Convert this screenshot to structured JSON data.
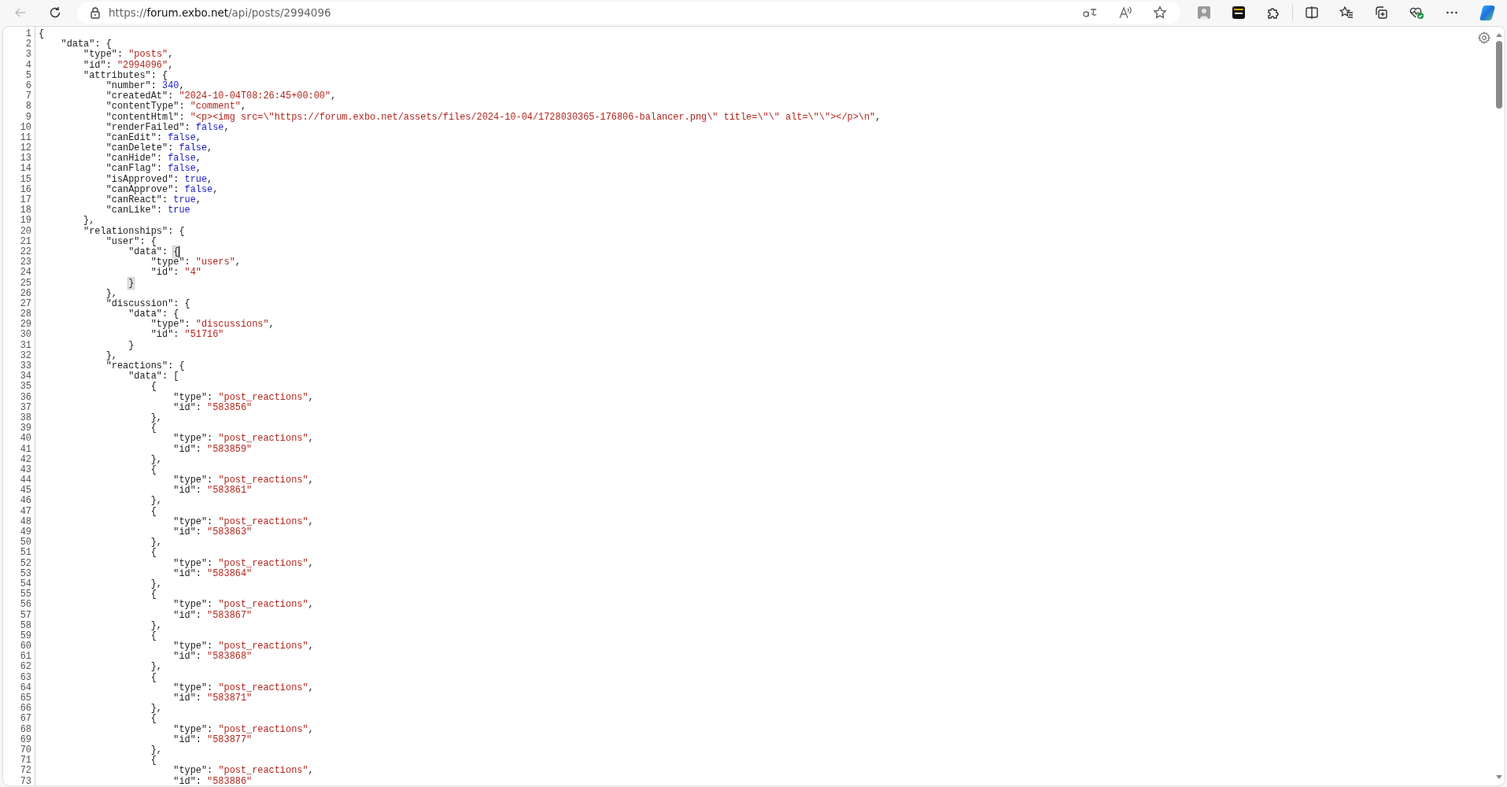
{
  "toolbar": {
    "back_button": {
      "disabled": true
    },
    "url": {
      "scheme": "https://",
      "host": "forum.exbo.net",
      "path": "/api/posts/2994096"
    }
  },
  "viewer": {
    "lines": [
      {
        "number": "1",
        "tokens": [
          {
            "kind": "punct",
            "text": "{"
          }
        ]
      },
      {
        "number": "2",
        "tokens": [
          {
            "kind": "key",
            "text": "\"data\""
          },
          {
            "kind": "punct",
            "text": ": {"
          }
        ]
      },
      {
        "number": "3",
        "tokens": [
          {
            "kind": "key",
            "text": "\"type\""
          },
          {
            "kind": "punct",
            "text": ": "
          },
          {
            "kind": "string",
            "text": "\"posts\""
          },
          {
            "kind": "punct",
            "text": ","
          }
        ]
      },
      {
        "number": "4",
        "tokens": [
          {
            "kind": "key",
            "text": "\"id\""
          },
          {
            "kind": "punct",
            "text": ": "
          },
          {
            "kind": "string",
            "text": "\"2994096\""
          },
          {
            "kind": "punct",
            "text": ","
          }
        ]
      },
      {
        "number": "5",
        "tokens": [
          {
            "kind": "key",
            "text": "\"attributes\""
          },
          {
            "kind": "punct",
            "text": ": {"
          }
        ]
      },
      {
        "number": "6",
        "tokens": [
          {
            "kind": "key",
            "text": "\"number\""
          },
          {
            "kind": "punct",
            "text": ": "
          },
          {
            "kind": "literal",
            "text": "340"
          },
          {
            "kind": "punct",
            "text": ","
          }
        ]
      },
      {
        "number": "7",
        "tokens": [
          {
            "kind": "key",
            "text": "\"createdAt\""
          },
          {
            "kind": "punct",
            "text": ": "
          },
          {
            "kind": "string",
            "text": "\"2024-10-04T08:26:45+00:00\""
          },
          {
            "kind": "punct",
            "text": ","
          }
        ]
      },
      {
        "number": "8",
        "tokens": [
          {
            "kind": "key",
            "text": "\"contentType\""
          },
          {
            "kind": "punct",
            "text": ": "
          },
          {
            "kind": "string",
            "text": "\"comment\""
          },
          {
            "kind": "punct",
            "text": ","
          }
        ]
      },
      {
        "number": "9",
        "tokens": [
          {
            "kind": "key",
            "text": "\"contentHtml\""
          },
          {
            "kind": "punct",
            "text": ": "
          },
          {
            "kind": "string",
            "text": "\"<p><img src=\\\"https://forum.exbo.net/assets/files/2024-10-04/1728030365-176806-balancer.png\\\" title=\\\"\\\" alt=\\\"\\\"></p>\\n\""
          },
          {
            "kind": "punct",
            "text": ","
          }
        ]
      },
      {
        "number": "10",
        "tokens": [
          {
            "kind": "key",
            "text": "\"renderFailed\""
          },
          {
            "kind": "punct",
            "text": ": "
          },
          {
            "kind": "literal",
            "text": "false"
          },
          {
            "kind": "punct",
            "text": ","
          }
        ]
      },
      {
        "number": "11",
        "tokens": [
          {
            "kind": "key",
            "text": "\"canEdit\""
          },
          {
            "kind": "punct",
            "text": ": "
          },
          {
            "kind": "literal",
            "text": "false"
          },
          {
            "kind": "punct",
            "text": ","
          }
        ]
      },
      {
        "number": "12",
        "tokens": [
          {
            "kind": "key",
            "text": "\"canDelete\""
          },
          {
            "kind": "punct",
            "text": ": "
          },
          {
            "kind": "literal",
            "text": "false"
          },
          {
            "kind": "punct",
            "text": ","
          }
        ]
      },
      {
        "number": "13",
        "tokens": [
          {
            "kind": "key",
            "text": "\"canHide\""
          },
          {
            "kind": "punct",
            "text": ": "
          },
          {
            "kind": "literal",
            "text": "false"
          },
          {
            "kind": "punct",
            "text": ","
          }
        ]
      },
      {
        "number": "14",
        "tokens": [
          {
            "kind": "key",
            "text": "\"canFlag\""
          },
          {
            "kind": "punct",
            "text": ": "
          },
          {
            "kind": "literal",
            "text": "false"
          },
          {
            "kind": "punct",
            "text": ","
          }
        ]
      },
      {
        "number": "15",
        "tokens": [
          {
            "kind": "key",
            "text": "\"isApproved\""
          },
          {
            "kind": "punct",
            "text": ": "
          },
          {
            "kind": "literal",
            "text": "true"
          },
          {
            "kind": "punct",
            "text": ","
          }
        ]
      },
      {
        "number": "16",
        "tokens": [
          {
            "kind": "key",
            "text": "\"canApprove\""
          },
          {
            "kind": "punct",
            "text": ": "
          },
          {
            "kind": "literal",
            "text": "false"
          },
          {
            "kind": "punct",
            "text": ","
          }
        ]
      },
      {
        "number": "17",
        "tokens": [
          {
            "kind": "key",
            "text": "\"canReact\""
          },
          {
            "kind": "punct",
            "text": ": "
          },
          {
            "kind": "literal",
            "text": "true"
          },
          {
            "kind": "punct",
            "text": ","
          }
        ]
      },
      {
        "number": "18",
        "tokens": [
          {
            "kind": "key",
            "text": "\"canLike\""
          },
          {
            "kind": "punct",
            "text": ": "
          },
          {
            "kind": "literal",
            "text": "true"
          }
        ]
      },
      {
        "number": "19",
        "tokens": [
          {
            "kind": "punct",
            "text": "},"
          }
        ]
      },
      {
        "number": "20",
        "tokens": [
          {
            "kind": "key",
            "text": "\"relationships\""
          },
          {
            "kind": "punct",
            "text": ": {"
          }
        ]
      },
      {
        "number": "21",
        "tokens": [
          {
            "kind": "key",
            "text": "\"user\""
          },
          {
            "kind": "punct",
            "text": ": {"
          }
        ]
      },
      {
        "number": "22",
        "tokens": [
          {
            "kind": "key",
            "text": "\"data\""
          },
          {
            "kind": "punct",
            "text": ": "
          },
          {
            "kind": "brace-cursor",
            "text": "{"
          }
        ]
      },
      {
        "number": "23",
        "tokens": [
          {
            "kind": "key",
            "text": "\"type\""
          },
          {
            "kind": "punct",
            "text": ": "
          },
          {
            "kind": "string",
            "text": "\"users\""
          },
          {
            "kind": "punct",
            "text": ","
          }
        ]
      },
      {
        "number": "24",
        "tokens": [
          {
            "kind": "key",
            "text": "\"id\""
          },
          {
            "kind": "punct",
            "text": ": "
          },
          {
            "kind": "string",
            "text": "\"4\""
          }
        ]
      },
      {
        "number": "25",
        "tokens": [
          {
            "kind": "brace-match",
            "text": "}"
          }
        ]
      },
      {
        "number": "26",
        "tokens": [
          {
            "kind": "punct",
            "text": "},"
          }
        ]
      },
      {
        "number": "27",
        "tokens": [
          {
            "kind": "key",
            "text": "\"discussion\""
          },
          {
            "kind": "punct",
            "text": ": {"
          }
        ]
      },
      {
        "number": "28",
        "tokens": [
          {
            "kind": "key",
            "text": "\"data\""
          },
          {
            "kind": "punct",
            "text": ": {"
          }
        ]
      },
      {
        "number": "29",
        "tokens": [
          {
            "kind": "key",
            "text": "\"type\""
          },
          {
            "kind": "punct",
            "text": ": "
          },
          {
            "kind": "string",
            "text": "\"discussions\""
          },
          {
            "kind": "punct",
            "text": ","
          }
        ]
      },
      {
        "number": "30",
        "tokens": [
          {
            "kind": "key",
            "text": "\"id\""
          },
          {
            "kind": "punct",
            "text": ": "
          },
          {
            "kind": "string",
            "text": "\"51716\""
          }
        ]
      },
      {
        "number": "31",
        "tokens": [
          {
            "kind": "punct",
            "text": "}"
          }
        ]
      },
      {
        "number": "32",
        "tokens": [
          {
            "kind": "punct",
            "text": "},"
          }
        ]
      },
      {
        "number": "33",
        "tokens": [
          {
            "kind": "key",
            "text": "\"reactions\""
          },
          {
            "kind": "punct",
            "text": ": {"
          }
        ]
      },
      {
        "number": "34",
        "tokens": [
          {
            "kind": "key",
            "text": "\"data\""
          },
          {
            "kind": "punct",
            "text": ": ["
          }
        ]
      },
      {
        "number": "35",
        "tokens": [
          {
            "kind": "punct",
            "text": "{"
          }
        ]
      },
      {
        "number": "36",
        "tokens": [
          {
            "kind": "key",
            "text": "\"type\""
          },
          {
            "kind": "punct",
            "text": ": "
          },
          {
            "kind": "string",
            "text": "\"post_reactions\""
          },
          {
            "kind": "punct",
            "text": ","
          }
        ]
      },
      {
        "number": "37",
        "tokens": [
          {
            "kind": "key",
            "text": "\"id\""
          },
          {
            "kind": "punct",
            "text": ": "
          },
          {
            "kind": "string",
            "text": "\"583856\""
          }
        ]
      },
      {
        "number": "38",
        "tokens": [
          {
            "kind": "punct",
            "text": "},"
          }
        ]
      },
      {
        "number": "39",
        "tokens": [
          {
            "kind": "punct",
            "text": "{"
          }
        ]
      },
      {
        "number": "40",
        "tokens": [
          {
            "kind": "key",
            "text": "\"type\""
          },
          {
            "kind": "punct",
            "text": ": "
          },
          {
            "kind": "string",
            "text": "\"post_reactions\""
          },
          {
            "kind": "punct",
            "text": ","
          }
        ]
      },
      {
        "number": "41",
        "tokens": [
          {
            "kind": "key",
            "text": "\"id\""
          },
          {
            "kind": "punct",
            "text": ": "
          },
          {
            "kind": "string",
            "text": "\"583859\""
          }
        ]
      },
      {
        "number": "42",
        "tokens": [
          {
            "kind": "punct",
            "text": "},"
          }
        ]
      },
      {
        "number": "43",
        "tokens": [
          {
            "kind": "punct",
            "text": "{"
          }
        ]
      },
      {
        "number": "44",
        "tokens": [
          {
            "kind": "key",
            "text": "\"type\""
          },
          {
            "kind": "punct",
            "text": ": "
          },
          {
            "kind": "string",
            "text": "\"post_reactions\""
          },
          {
            "kind": "punct",
            "text": ","
          }
        ]
      },
      {
        "number": "45",
        "tokens": [
          {
            "kind": "key",
            "text": "\"id\""
          },
          {
            "kind": "punct",
            "text": ": "
          },
          {
            "kind": "string",
            "text": "\"583861\""
          }
        ]
      },
      {
        "number": "46",
        "tokens": [
          {
            "kind": "punct",
            "text": "},"
          }
        ]
      },
      {
        "number": "47",
        "tokens": [
          {
            "kind": "punct",
            "text": "{"
          }
        ]
      },
      {
        "number": "48",
        "tokens": [
          {
            "kind": "key",
            "text": "\"type\""
          },
          {
            "kind": "punct",
            "text": ": "
          },
          {
            "kind": "string",
            "text": "\"post_reactions\""
          },
          {
            "kind": "punct",
            "text": ","
          }
        ]
      },
      {
        "number": "49",
        "tokens": [
          {
            "kind": "key",
            "text": "\"id\""
          },
          {
            "kind": "punct",
            "text": ": "
          },
          {
            "kind": "string",
            "text": "\"583863\""
          }
        ]
      },
      {
        "number": "50",
        "tokens": [
          {
            "kind": "punct",
            "text": "},"
          }
        ]
      },
      {
        "number": "51",
        "tokens": [
          {
            "kind": "punct",
            "text": "{"
          }
        ]
      },
      {
        "number": "52",
        "tokens": [
          {
            "kind": "key",
            "text": "\"type\""
          },
          {
            "kind": "punct",
            "text": ": "
          },
          {
            "kind": "string",
            "text": "\"post_reactions\""
          },
          {
            "kind": "punct",
            "text": ","
          }
        ]
      },
      {
        "number": "53",
        "tokens": [
          {
            "kind": "key",
            "text": "\"id\""
          },
          {
            "kind": "punct",
            "text": ": "
          },
          {
            "kind": "string",
            "text": "\"583864\""
          }
        ]
      },
      {
        "number": "54",
        "tokens": [
          {
            "kind": "punct",
            "text": "},"
          }
        ]
      },
      {
        "number": "55",
        "tokens": [
          {
            "kind": "punct",
            "text": "{"
          }
        ]
      },
      {
        "number": "56",
        "tokens": [
          {
            "kind": "key",
            "text": "\"type\""
          },
          {
            "kind": "punct",
            "text": ": "
          },
          {
            "kind": "string",
            "text": "\"post_reactions\""
          },
          {
            "kind": "punct",
            "text": ","
          }
        ]
      },
      {
        "number": "57",
        "tokens": [
          {
            "kind": "key",
            "text": "\"id\""
          },
          {
            "kind": "punct",
            "text": ": "
          },
          {
            "kind": "string",
            "text": "\"583867\""
          }
        ]
      },
      {
        "number": "58",
        "tokens": [
          {
            "kind": "punct",
            "text": "},"
          }
        ]
      },
      {
        "number": "59",
        "tokens": [
          {
            "kind": "punct",
            "text": "{"
          }
        ]
      },
      {
        "number": "60",
        "tokens": [
          {
            "kind": "key",
            "text": "\"type\""
          },
          {
            "kind": "punct",
            "text": ": "
          },
          {
            "kind": "string",
            "text": "\"post_reactions\""
          },
          {
            "kind": "punct",
            "text": ","
          }
        ]
      },
      {
        "number": "61",
        "tokens": [
          {
            "kind": "key",
            "text": "\"id\""
          },
          {
            "kind": "punct",
            "text": ": "
          },
          {
            "kind": "string",
            "text": "\"583868\""
          }
        ]
      },
      {
        "number": "62",
        "tokens": [
          {
            "kind": "punct",
            "text": "},"
          }
        ]
      },
      {
        "number": "63",
        "tokens": [
          {
            "kind": "punct",
            "text": "{"
          }
        ]
      },
      {
        "number": "64",
        "tokens": [
          {
            "kind": "key",
            "text": "\"type\""
          },
          {
            "kind": "punct",
            "text": ": "
          },
          {
            "kind": "string",
            "text": "\"post_reactions\""
          },
          {
            "kind": "punct",
            "text": ","
          }
        ]
      },
      {
        "number": "65",
        "tokens": [
          {
            "kind": "key",
            "text": "\"id\""
          },
          {
            "kind": "punct",
            "text": ": "
          },
          {
            "kind": "string",
            "text": "\"583871\""
          }
        ]
      },
      {
        "number": "66",
        "tokens": [
          {
            "kind": "punct",
            "text": "},"
          }
        ]
      },
      {
        "number": "67",
        "tokens": [
          {
            "kind": "punct",
            "text": "{"
          }
        ]
      },
      {
        "number": "68",
        "tokens": [
          {
            "kind": "key",
            "text": "\"type\""
          },
          {
            "kind": "punct",
            "text": ": "
          },
          {
            "kind": "string",
            "text": "\"post_reactions\""
          },
          {
            "kind": "punct",
            "text": ","
          }
        ]
      },
      {
        "number": "69",
        "tokens": [
          {
            "kind": "key",
            "text": "\"id\""
          },
          {
            "kind": "punct",
            "text": ": "
          },
          {
            "kind": "string",
            "text": "\"583877\""
          }
        ]
      },
      {
        "number": "70",
        "tokens": [
          {
            "kind": "punct",
            "text": "},"
          }
        ]
      },
      {
        "number": "71",
        "tokens": [
          {
            "kind": "punct",
            "text": "{"
          }
        ]
      },
      {
        "number": "72",
        "tokens": [
          {
            "kind": "key",
            "text": "\"type\""
          },
          {
            "kind": "punct",
            "text": ": "
          },
          {
            "kind": "string",
            "text": "\"post_reactions\""
          },
          {
            "kind": "punct",
            "text": ","
          }
        ]
      },
      {
        "number": "73",
        "tokens": [
          {
            "kind": "key",
            "text": "\"id\""
          },
          {
            "kind": "punct",
            "text": ": "
          },
          {
            "kind": "string",
            "text": "\"583886\""
          }
        ]
      }
    ]
  }
}
